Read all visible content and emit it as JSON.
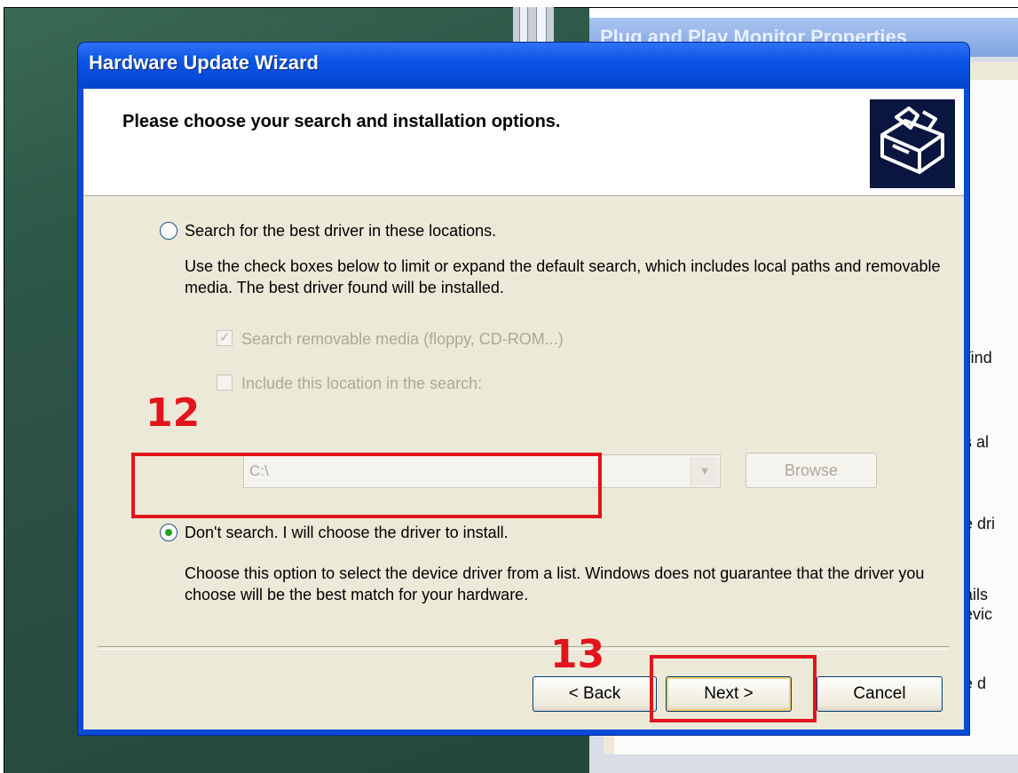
{
  "background_window": {
    "title": "Plug and Play Monitor Properties",
    "fragments": [
      "Vind",
      "s al",
      "e dri",
      "ails",
      "evic",
      "e d"
    ]
  },
  "wizard": {
    "title": "Hardware Update Wizard",
    "heading": "Please choose your search and installation options.",
    "option_search": {
      "label": "Search for the best driver in these locations.",
      "selected": false,
      "description": "Use the check boxes below to limit or expand the default search, which includes local paths and removable media. The best driver found will be installed."
    },
    "check_removable": {
      "label": "Search removable media (floppy, CD-ROM...)",
      "checked": true,
      "enabled": false
    },
    "check_location": {
      "label": "Include this location in the search:",
      "checked": false,
      "enabled": false
    },
    "location_combo": {
      "value": "C:\\"
    },
    "browse_label": "Browse",
    "option_dont_search": {
      "label": "Don't search. I will choose the driver to install.",
      "selected": true,
      "description": "Choose this option to select the device driver from a list.  Windows does not guarantee that the driver you choose will be the best match for your hardware."
    },
    "buttons": {
      "back": "< Back",
      "next": "Next >",
      "cancel": "Cancel"
    }
  },
  "annotations": {
    "step_a": "12",
    "step_b": "13",
    "color": "#e3141b"
  }
}
